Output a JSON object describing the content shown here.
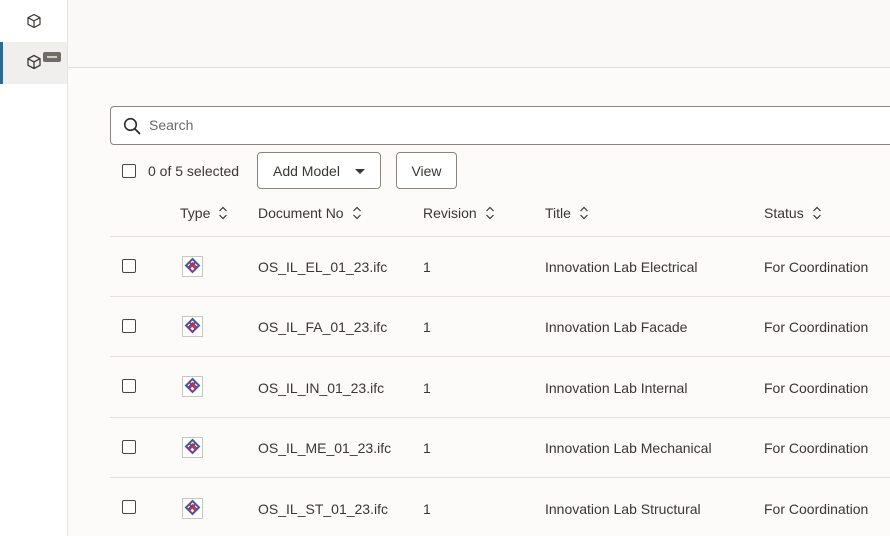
{
  "rail": {
    "items": [
      {
        "icon": "cube-icon"
      },
      {
        "icon": "cube-icon",
        "active": true,
        "badge": "new-badge"
      }
    ]
  },
  "search": {
    "placeholder": "Search"
  },
  "toolbar": {
    "selection": "0 of 5 selected",
    "add_model_label": "Add Model",
    "view_label": "View"
  },
  "table": {
    "columns": [
      "Type",
      "Document No",
      "Revision",
      "Title",
      "Status"
    ],
    "rows": [
      {
        "type": "ifc-file-icon",
        "document_no": "OS_IL_EL_01_23.ifc",
        "revision": "1",
        "title": "Innovation Lab Electrical",
        "status": "For Coordination"
      },
      {
        "type": "ifc-file-icon",
        "document_no": "OS_IL_FA_01_23.ifc",
        "revision": "1",
        "title": "Innovation Lab Facade",
        "status": "For Coordination"
      },
      {
        "type": "ifc-file-icon",
        "document_no": "OS_IL_IN_01_23.ifc",
        "revision": "1",
        "title": "Innovation Lab Internal",
        "status": "For Coordination"
      },
      {
        "type": "ifc-file-icon",
        "document_no": "OS_IL_ME_01_23.ifc",
        "revision": "1",
        "title": "Innovation Lab Mechanical",
        "status": "For Coordination"
      },
      {
        "type": "ifc-file-icon",
        "document_no": "OS_IL_ST_01_23.ifc",
        "revision": "1",
        "title": "Innovation Lab Structural",
        "status": "For Coordination"
      }
    ]
  },
  "colors": {
    "accent": "#2c6a91",
    "border": "#8a8580",
    "text": "#3a3632"
  }
}
